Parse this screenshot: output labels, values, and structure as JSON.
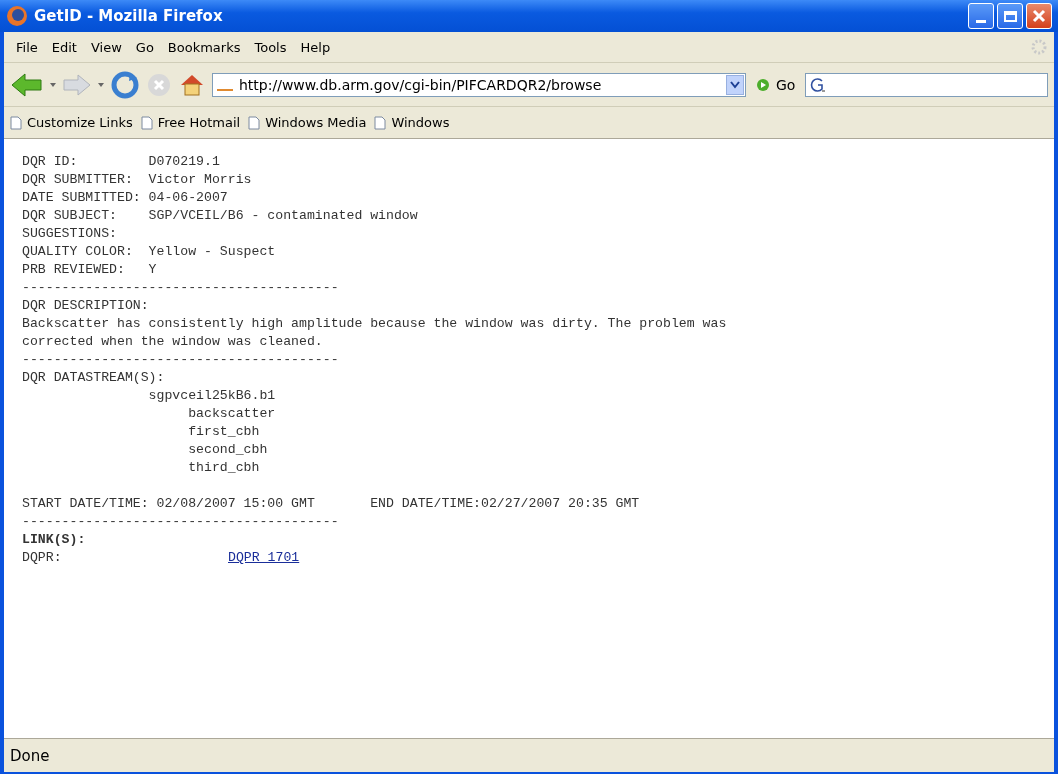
{
  "window": {
    "title": "GetID - Mozilla Firefox"
  },
  "menu": [
    "File",
    "Edit",
    "View",
    "Go",
    "Bookmarks",
    "Tools",
    "Help"
  ],
  "toolbar": {
    "url": "http://www.db.arm.gov/cgi-bin/PIFCARDQR2/browse",
    "go": "Go"
  },
  "bookmarks": [
    "Customize Links",
    "Free Hotmail",
    "Windows Media",
    "Windows"
  ],
  "content": [
    {
      "kind": "text",
      "text": "DQR ID:         D070219.1"
    },
    {
      "kind": "text",
      "text": "DQR SUBMITTER:  Victor Morris"
    },
    {
      "kind": "text",
      "text": "DATE SUBMITTED: 04-06-2007"
    },
    {
      "kind": "text",
      "text": "DQR SUBJECT:    SGP/VCEIL/B6 - contaminated window"
    },
    {
      "kind": "text",
      "text": "SUGGESTIONS:"
    },
    {
      "kind": "text",
      "text": "QUALITY COLOR:  Yellow - Suspect"
    },
    {
      "kind": "text",
      "text": "PRB REVIEWED:   Y"
    },
    {
      "kind": "text",
      "text": "----------------------------------------"
    },
    {
      "kind": "text",
      "text": "DQR DESCRIPTION:"
    },
    {
      "kind": "text",
      "text": "Backscatter has consistently high amplitude because the window was dirty. The problem was"
    },
    {
      "kind": "text",
      "text": "corrected when the window was cleaned."
    },
    {
      "kind": "text",
      "text": "----------------------------------------"
    },
    {
      "kind": "text",
      "text": "DQR DATASTREAM(S):"
    },
    {
      "kind": "text",
      "text": "                sgpvceil25kB6.b1"
    },
    {
      "kind": "text",
      "text": "                     backscatter"
    },
    {
      "kind": "text",
      "text": "                     first_cbh"
    },
    {
      "kind": "text",
      "text": "                     second_cbh"
    },
    {
      "kind": "text",
      "text": "                     third_cbh"
    },
    {
      "kind": "blank"
    },
    {
      "kind": "text",
      "text": "START DATE/TIME: 02/08/2007 15:00 GMT       END DATE/TIME:02/27/2007 20:35 GMT"
    },
    {
      "kind": "text",
      "text": "----------------------------------------"
    },
    {
      "kind": "bold",
      "text": "LINK(S):"
    },
    {
      "kind": "link",
      "label": "DQPR:",
      "link": "DQPR 1701"
    }
  ],
  "status_bar": "Done"
}
